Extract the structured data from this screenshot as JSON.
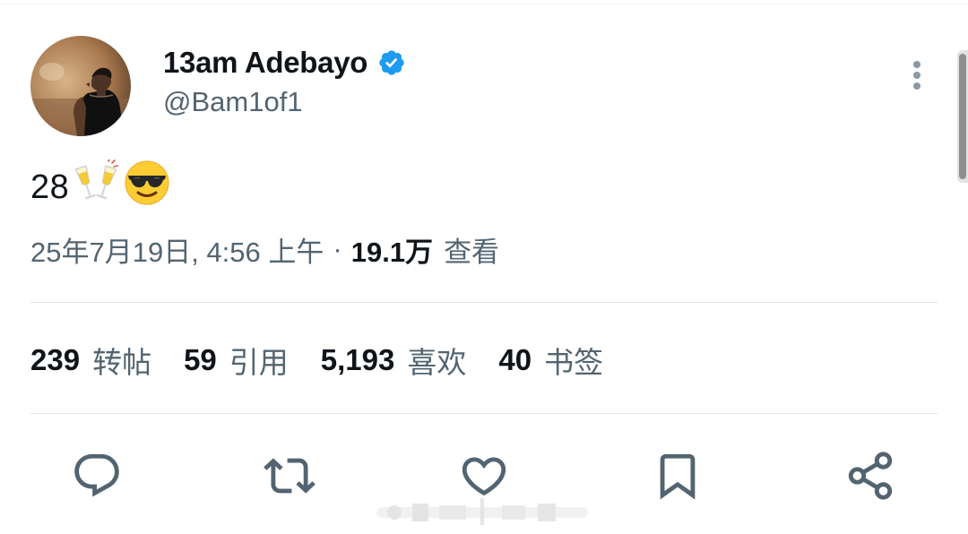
{
  "author": {
    "name": "13am Adebayo",
    "handle": "@Bam1of1",
    "verified": true,
    "avatar_icon": "profile-photo"
  },
  "tweet": {
    "text": "28",
    "emojis": [
      "clinking-glasses-emoji",
      "sunglasses-face-emoji"
    ]
  },
  "meta": {
    "timestamp": "25年7月19日, 4:56 上午",
    "separator": "·",
    "views_count": "19.1万",
    "views_label": "查看"
  },
  "stats": [
    {
      "count": "239",
      "label": "转帖"
    },
    {
      "count": "59",
      "label": "引用"
    },
    {
      "count": "5,193",
      "label": "喜欢"
    },
    {
      "count": "40",
      "label": "书签"
    }
  ],
  "actions": [
    "reply-icon",
    "retweet-icon",
    "like-icon",
    "bookmark-icon",
    "share-icon"
  ],
  "colors": {
    "text_primary": "#0f1419",
    "text_secondary": "#536471",
    "verified_blue": "#1d9bf0",
    "divider": "#dfe4e7",
    "action_icon": "#536471"
  }
}
